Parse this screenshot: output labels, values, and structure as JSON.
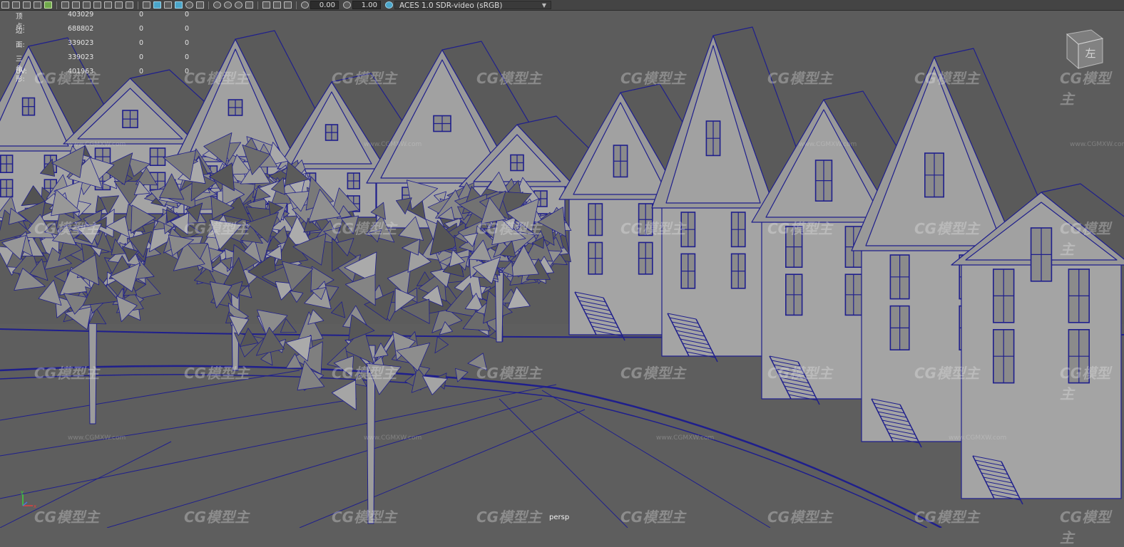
{
  "toolbar": {
    "exposure_value": "0.00",
    "gamma_value": "1.00",
    "color_space": "ACES 1.0 SDR-video (sRGB)",
    "icons": [
      "camera-attributes-icon",
      "bookmark-icon",
      "image-plane-icon",
      "2d-pan-icon",
      "grease-pencil-icon",
      "grid-icon",
      "film-gate-icon",
      "resolution-gate-icon",
      "gate-mask-icon",
      "field-chart-icon",
      "safe-action-icon",
      "safe-title-icon",
      "wireframe-icon",
      "smooth-shade-icon",
      "wireframe-on-shaded-icon",
      "textured-icon",
      "use-all-lights-icon",
      "shadows-icon",
      "screen-space-ao-icon",
      "motion-blur-icon",
      "anti-aliasing-icon",
      "isolate-select-icon",
      "xray-icon",
      "xray-joints-icon",
      "exposure-icon",
      "gamma-icon",
      "color-management-icon"
    ]
  },
  "hud": {
    "rows": [
      {
        "label": "顶点:",
        "value": "403029",
        "c1": "0",
        "c2": "0"
      },
      {
        "label": "边:",
        "value": "688802",
        "c1": "0",
        "c2": "0"
      },
      {
        "label": "面:",
        "value": "339023",
        "c1": "0",
        "c2": "0"
      },
      {
        "label": "三角形:",
        "value": "339023",
        "c1": "0",
        "c2": "0"
      },
      {
        "label": "UV:",
        "value": "401963",
        "c1": "0",
        "c2": "0"
      }
    ]
  },
  "viewport": {
    "camera": "persp",
    "viewcube_label": "左",
    "wire_color": "#1f1f8c",
    "surface_color": "#a4a4a4",
    "ground_color": "#5c5c5c"
  },
  "watermark": {
    "text": "CG模型主",
    "url": "www.CGMXW.com"
  },
  "axis": {
    "x_label": "x",
    "y_label": "y"
  }
}
